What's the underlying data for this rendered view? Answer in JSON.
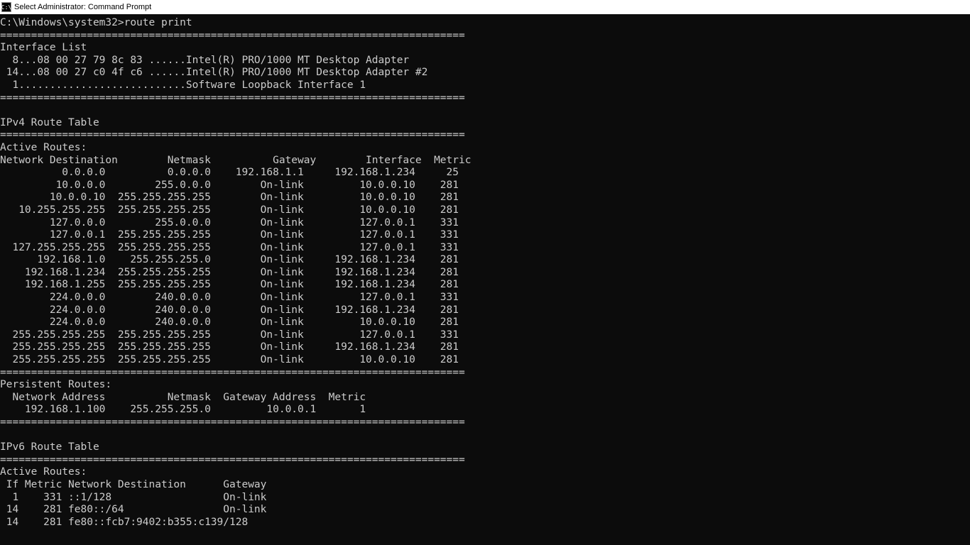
{
  "window": {
    "title": "Select Administrator: Command Prompt",
    "icon_label": "C:\\"
  },
  "terminal": {
    "prompt": "C:\\Windows\\system32>",
    "command": "route print",
    "separator": "===========================================================================",
    "interface_list_title": "Interface List",
    "interfaces": [
      "  8...08 00 27 79 8c 83 ......Intel(R) PRO/1000 MT Desktop Adapter",
      " 14...08 00 27 c0 4f c6 ......Intel(R) PRO/1000 MT Desktop Adapter #2",
      "  1...........................Software Loopback Interface 1"
    ],
    "ipv4_title": "IPv4 Route Table",
    "active_routes_title": "Active Routes:",
    "ipv4_header": {
      "dest": "Network Destination",
      "netmask": "Netmask",
      "gateway": "Gateway",
      "interface": "Interface",
      "metric": "Metric"
    },
    "ipv4_routes": [
      {
        "dest": "0.0.0.0",
        "mask": "0.0.0.0",
        "gw": "192.168.1.1",
        "if": "192.168.1.234",
        "metric": "25"
      },
      {
        "dest": "10.0.0.0",
        "mask": "255.0.0.0",
        "gw": "On-link",
        "if": "10.0.0.10",
        "metric": "281"
      },
      {
        "dest": "10.0.0.10",
        "mask": "255.255.255.255",
        "gw": "On-link",
        "if": "10.0.0.10",
        "metric": "281"
      },
      {
        "dest": "10.255.255.255",
        "mask": "255.255.255.255",
        "gw": "On-link",
        "if": "10.0.0.10",
        "metric": "281"
      },
      {
        "dest": "127.0.0.0",
        "mask": "255.0.0.0",
        "gw": "On-link",
        "if": "127.0.0.1",
        "metric": "331"
      },
      {
        "dest": "127.0.0.1",
        "mask": "255.255.255.255",
        "gw": "On-link",
        "if": "127.0.0.1",
        "metric": "331"
      },
      {
        "dest": "127.255.255.255",
        "mask": "255.255.255.255",
        "gw": "On-link",
        "if": "127.0.0.1",
        "metric": "331"
      },
      {
        "dest": "192.168.1.0",
        "mask": "255.255.255.0",
        "gw": "On-link",
        "if": "192.168.1.234",
        "metric": "281"
      },
      {
        "dest": "192.168.1.234",
        "mask": "255.255.255.255",
        "gw": "On-link",
        "if": "192.168.1.234",
        "metric": "281"
      },
      {
        "dest": "192.168.1.255",
        "mask": "255.255.255.255",
        "gw": "On-link",
        "if": "192.168.1.234",
        "metric": "281"
      },
      {
        "dest": "224.0.0.0",
        "mask": "240.0.0.0",
        "gw": "On-link",
        "if": "127.0.0.1",
        "metric": "331"
      },
      {
        "dest": "224.0.0.0",
        "mask": "240.0.0.0",
        "gw": "On-link",
        "if": "192.168.1.234",
        "metric": "281"
      },
      {
        "dest": "224.0.0.0",
        "mask": "240.0.0.0",
        "gw": "On-link",
        "if": "10.0.0.10",
        "metric": "281"
      },
      {
        "dest": "255.255.255.255",
        "mask": "255.255.255.255",
        "gw": "On-link",
        "if": "127.0.0.1",
        "metric": "331"
      },
      {
        "dest": "255.255.255.255",
        "mask": "255.255.255.255",
        "gw": "On-link",
        "if": "192.168.1.234",
        "metric": "281"
      },
      {
        "dest": "255.255.255.255",
        "mask": "255.255.255.255",
        "gw": "On-link",
        "if": "10.0.0.10",
        "metric": "281"
      }
    ],
    "persistent_title": "Persistent Routes:",
    "persistent_header": {
      "addr": "Network Address",
      "netmask": "Netmask",
      "gw": "Gateway Address",
      "metric": "Metric"
    },
    "persistent_routes": [
      {
        "addr": "192.168.1.100",
        "mask": "255.255.255.0",
        "gw": "10.0.0.1",
        "metric": "1"
      }
    ],
    "ipv6_title": "IPv6 Route Table",
    "ipv6_header": " If Metric Network Destination      Gateway",
    "ipv6_routes": [
      {
        "if": "1",
        "metric": "331",
        "dest": "::1/128",
        "gw": "On-link"
      },
      {
        "if": "14",
        "metric": "281",
        "dest": "fe80::/64",
        "gw": "On-link"
      },
      {
        "if": "14",
        "metric": "281",
        "dest": "fe80::fcb7:9402:b355:c139/128",
        "gw": ""
      }
    ]
  }
}
